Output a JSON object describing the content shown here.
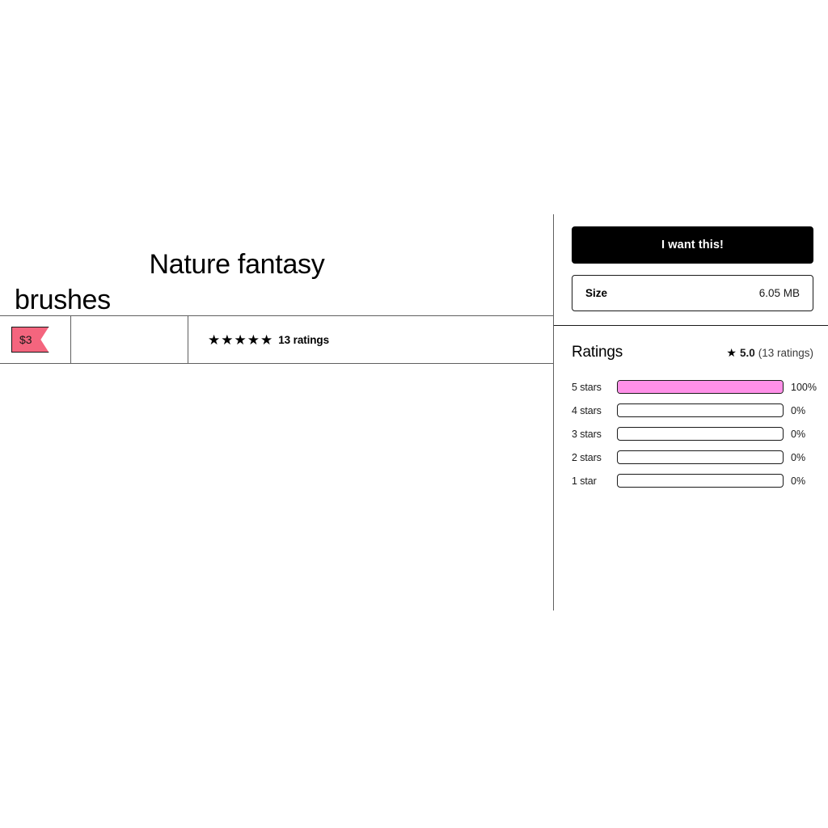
{
  "product": {
    "title_line_1": "Nature fantasy",
    "title_line_2": "brushes",
    "price": "$3",
    "stars_glyphs": "★★★★★",
    "ratings_count_label": "13 ratings"
  },
  "sidebar": {
    "cta_label": "I want this!",
    "attributes": [
      {
        "label": "Size",
        "value": "6.05 MB"
      }
    ],
    "ratings": {
      "heading": "Ratings",
      "star_glyph": "★",
      "average": "5.0",
      "count_label": "(13 ratings)",
      "histogram": [
        {
          "label": "5 stars",
          "percent_label": "100%",
          "percent": 100
        },
        {
          "label": "4 stars",
          "percent_label": "0%",
          "percent": 0
        },
        {
          "label": "3 stars",
          "percent_label": "0%",
          "percent": 0
        },
        {
          "label": "2 stars",
          "percent_label": "0%",
          "percent": 0
        },
        {
          "label": "1 star",
          "percent_label": "0%",
          "percent": 0
        }
      ]
    }
  },
  "colors": {
    "accent_pink": "#ff90e8",
    "price_tag": "#f4657e",
    "cta_bg": "#000000",
    "border": "#1a1a1a",
    "divider": "#5f5f5f"
  }
}
